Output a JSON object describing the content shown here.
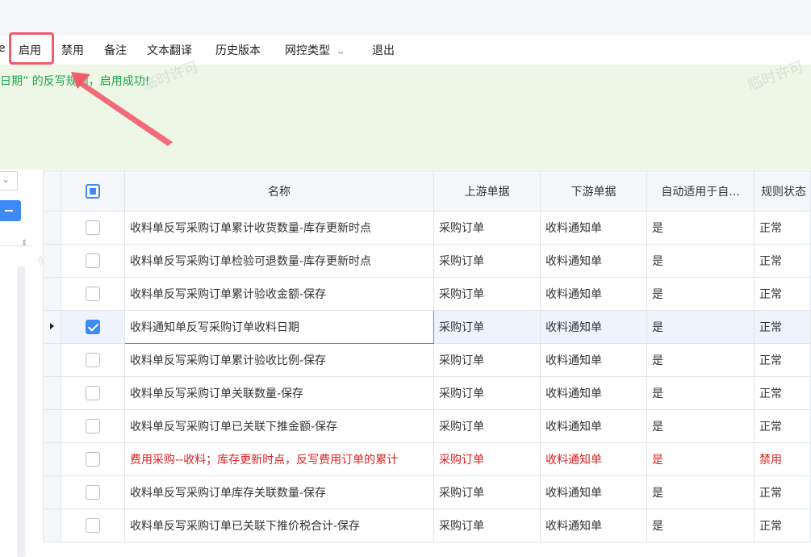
{
  "toolbar": {
    "fragment": "e",
    "items": [
      "启用",
      "禁用",
      "备注",
      "文本翻译",
      "历史版本",
      "网控类型",
      "退出"
    ]
  },
  "message": "日期” 的反写规则，启用成功!",
  "watermark": "临时许可",
  "grid": {
    "columns": [
      "名称",
      "上游单据",
      "下游单据",
      "自动适用于自...",
      "规则状态"
    ],
    "rows": [
      {
        "name": "收料单反写采购订单累计收货数量-库存更新时点",
        "up": "采购订单",
        "down": "收料通知单",
        "auto": "是",
        "status": "正常",
        "checked": false
      },
      {
        "name": "收料单反写采购订单检验可退数量-库存更新时点",
        "up": "采购订单",
        "down": "收料通知单",
        "auto": "是",
        "status": "正常",
        "checked": false
      },
      {
        "name": "收料单反写采购订单累计验收金额-保存",
        "up": "采购订单",
        "down": "收料通知单",
        "auto": "是",
        "status": "正常",
        "checked": false
      },
      {
        "name": "收料通知单反写采购订单收料日期",
        "up": "采购订单",
        "down": "收料通知单",
        "auto": "是",
        "status": "正常",
        "checked": true
      },
      {
        "name": "收料单反写采购订单累计验收比例-保存",
        "up": "采购订单",
        "down": "收料通知单",
        "auto": "是",
        "status": "正常",
        "checked": false
      },
      {
        "name": "收料单反写采购订单关联数量-保存",
        "up": "采购订单",
        "down": "收料通知单",
        "auto": "是",
        "status": "正常",
        "checked": false
      },
      {
        "name": "收料单反写采购订单已关联下推金额-保存",
        "up": "采购订单",
        "down": "收料通知单",
        "auto": "是",
        "status": "正常",
        "checked": false
      },
      {
        "name": "费用采购--收料；库存更新时点，反写费用订单的累计",
        "up": "采购订单",
        "down": "收料通知单",
        "auto": "是",
        "status": "禁用",
        "checked": false
      },
      {
        "name": "收料单反写采购订单库存关联数量-保存",
        "up": "采购订单",
        "down": "收料通知单",
        "auto": "是",
        "status": "正常",
        "checked": false
      },
      {
        "name": "收料单反写采购订单已关联下推价税合计-保存",
        "up": "采购订单",
        "down": "收料通知单",
        "auto": "是",
        "status": "正常",
        "checked": false
      }
    ]
  },
  "colors": {
    "success": "#1aa34a",
    "disabled_row": "#e02020",
    "accent": "#3d8af7",
    "highlight": "#f15b6c"
  }
}
